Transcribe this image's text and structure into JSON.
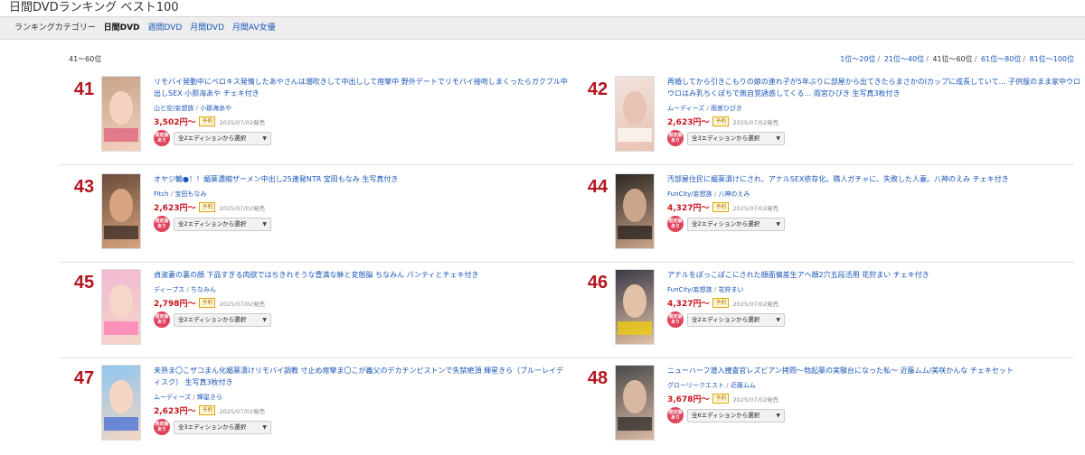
{
  "page": {
    "title": "日間DVDランキング ベスト100"
  },
  "category_bar": {
    "label": "ランキングカテゴリー",
    "items": [
      {
        "label": "日間DVD",
        "active": true
      },
      {
        "label": "週間DVD",
        "active": false
      },
      {
        "label": "月間DVD",
        "active": false
      },
      {
        "label": "月間AV女優",
        "active": false
      }
    ]
  },
  "range": {
    "label": "41〜60位"
  },
  "pager": [
    "1位〜20位",
    "21位〜40位",
    "41位〜60位",
    "61位〜80位",
    "81位〜100位"
  ],
  "pager_current_index": 2,
  "common": {
    "preorder_tag": "予約",
    "badge": "限定版あり",
    "caret": "▼"
  },
  "entries": [
    {
      "rank": "41",
      "title": "リモバイ発動中にベロキス発情したあやさんは潮吹きして中出しして痙攣中 野外デートでリモバイ接吻しまくったらガクブル中出しSEX 小那海あや チェキ付き",
      "maker": "山と空/妄想族",
      "actress": "小那海あや",
      "price": "3,502円〜",
      "date": "2025/07/02発売",
      "edition": "全2エディションから選択"
    },
    {
      "rank": "42",
      "title": "再婚してから引きこもりの娘の連れ子が5年ぶりに部屋から出てきたらまさかのIカップに成長していて… 子供服のまま家中ウロウロはみ乳ちくぽちで無自覚誘惑してくる… 雨宮ひびき 生写真3枚付き",
      "maker": "ムーディーズ",
      "actress": "雨宮ひびき",
      "price": "2,623円〜",
      "date": "2025/07/02発売",
      "edition": "全3エディションから選択"
    },
    {
      "rank": "43",
      "title": "オヤジ輪●！！媚薬濃縮ザーメン中出し25連発NTR 宝田もなみ 生写真付き",
      "maker": "Fitch",
      "actress": "宝田もなみ",
      "price": "2,623円〜",
      "date": "2025/07/02発売",
      "edition": "全2エディションから選択"
    },
    {
      "rank": "44",
      "title": "汚部屋住民に媚薬漬けにされ、アナルSEX依存化。隣人ガチャに、失敗した人妻。八神のえみ チェキ付き",
      "maker": "FunCity/妄想族",
      "actress": "八神のえみ",
      "price": "4,327円〜",
      "date": "2025/07/02発売",
      "edition": "全2エディションから選択"
    },
    {
      "rank": "45",
      "title": "貞淑妻の裏の顔 下品すぎる肉欲ではちきれそうな豊満な躰と変態脳 ちなみん パンティとチェキ付き",
      "maker": "ディープス",
      "actress": "ちなみん",
      "price": "2,798円〜",
      "date": "2025/07/02発売",
      "edition": "全2エディションから選択"
    },
    {
      "rank": "46",
      "title": "アナルをぽっこぽこにされた顔面偏差生アヘ顔2穴五段活用 花狩まい チェキ付き",
      "maker": "FunCity/妄想族",
      "actress": "花狩まい",
      "price": "4,327円〜",
      "date": "2025/07/02発売",
      "edition": "全2エディションから選択"
    },
    {
      "rank": "47",
      "title": "未熟ま〇こザコまん化媚薬漬けリモバイ調教 寸止め痙攣ま〇こが義父のデカチンピストンで失禁絶頂 輝星きら（ブルーレイディスク） 生写真3枚付き",
      "maker": "ムーディーズ",
      "actress": "輝星きら",
      "price": "2,623円〜",
      "date": "2025/07/02発売",
      "edition": "全3エディションから選択"
    },
    {
      "rank": "48",
      "title": "ニューハーフ潜入捜査官レズビアン拷問～勃起薬の実験台になった私～ 近藤ムム/美咲かんな チェキセット",
      "maker": "グローリークエスト",
      "actress": "近藤ムム",
      "price": "3,678円〜",
      "date": "2025/07/02発売",
      "edition": "全6エディションから選択"
    }
  ]
}
